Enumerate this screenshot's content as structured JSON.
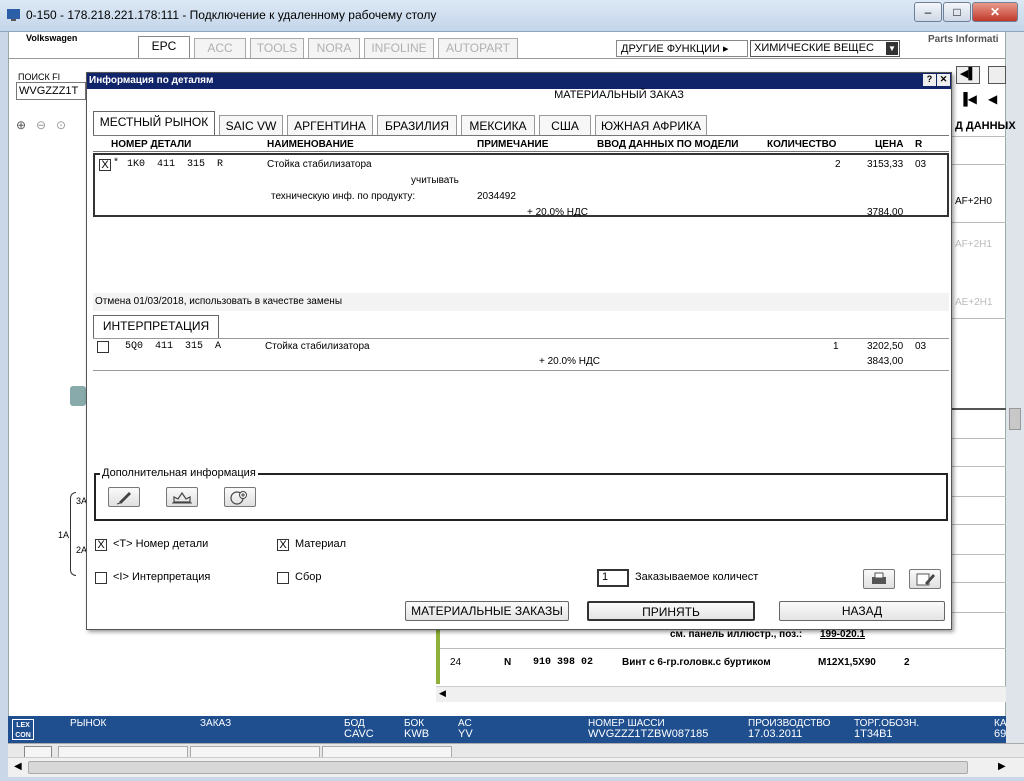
{
  "window": {
    "title": "0-150 - 178.218.221.178:111 - Подключение к удаленному рабочему столу",
    "controls": [
      "–",
      "□",
      "✕"
    ]
  },
  "app": {
    "brand": "Volkswagen",
    "logo_text": "Parts Informati",
    "tabs": [
      "EPC",
      "ACC",
      "TOOLS",
      "NORA",
      "INFOLINE",
      "AUTOPART"
    ],
    "other_functions": "ДРУГИЕ ФУНКЦИИ ▸",
    "chem_select": "ХИМИЧЕСКИЕ ВЕЩЕС",
    "search_label": "ПОИСК FI",
    "search_value": "WVGZZZ1T",
    "right_header": "Д ДАННЫХ",
    "bg_codes": [
      "AF+2H0",
      "AF+2H1",
      "AE+2H1"
    ],
    "tree_labels": [
      "3A",
      "1A",
      "2A"
    ],
    "panel_text": "см. панель иллюстр., поз.:",
    "panel_link": "199-020.1",
    "bg_row": {
      "pos": "24",
      "flag": "N",
      "part": "910 398 02",
      "name": "Винт с 6-гр.головк.с буртиком",
      "spec": "M12X1,5X90",
      "qty": "2"
    }
  },
  "status_bar": {
    "logo": "LEX CON",
    "fields": [
      {
        "label": "РЫНОК",
        "value": ""
      },
      {
        "label": "ЗАКАЗ",
        "value": ""
      },
      {
        "label": "БОД",
        "value": "CAVC"
      },
      {
        "label": "БОК",
        "value": "KWB"
      },
      {
        "label": "АС",
        "value": "YV"
      },
      {
        "label": "НОМЕР ШАССИ",
        "value": "WVGZZZ1TZBW087185"
      },
      {
        "label": "ПРОИЗВОДСТВО",
        "value": "17.03.2011"
      },
      {
        "label": "ТОРГ.ОБОЗН.",
        "value": "1T34B1"
      },
      {
        "label": "КА",
        "value": "69"
      }
    ]
  },
  "dialog": {
    "title": "Информация по деталям",
    "help": "?",
    "close": "✕",
    "heading": "МАТЕРИАЛЬНЫЙ ЗАКАЗ",
    "market_tabs": [
      "МЕСТНЫЙ РЫНОК",
      "SAIC VW",
      "АРГЕНТИНА",
      "БРАЗИЛИЯ",
      "МЕКСИКА",
      "США",
      "ЮЖНАЯ АФРИКА"
    ],
    "columns": [
      "НОМЕР ДЕТАЛИ",
      "НАИМЕНОВАНИЕ",
      "ПРИМЕЧАНИЕ",
      "ВВОД ДАННЫХ ПО МОДЕЛИ",
      "КОЛИЧЕСТВО",
      "ЦЕНА",
      "R"
    ],
    "main_item": {
      "checked": "X",
      "star": "*",
      "part": "1K0  411  315  R",
      "name": "Стойка стабилизатора",
      "note1": "учитывать",
      "note2": "техническую инф. по продукту:",
      "note2_value": "2034492",
      "qty": "2",
      "price": "3153,33",
      "r": "03",
      "vat_label": "+ 20.0% НДС",
      "vat_price": "3784,00"
    },
    "replacement_text": "Отмена 01/03/2018, использовать в качестве замены",
    "interp_tab": "ИНТЕРПРЕТАЦИЯ",
    "interp_item": {
      "part": "5Q0  411  315  A",
      "name": "Стойка стабилизатора",
      "qty": "1",
      "price": "3202,50",
      "r": "03",
      "vat_label": "+ 20.0% НДС",
      "vat_price": "3843,00"
    },
    "extra_info_label": "Дополнительная информация",
    "extra_icons": [
      "pencil-icon",
      "crown-tool-icon",
      "circle-plus-icon"
    ],
    "options": {
      "part_number": "<T> Номер детали",
      "material": "Материал",
      "interpretation": "<I> Интерпретация",
      "assembly": "Сбор"
    },
    "order_qty_value": "1",
    "order_qty_label": "Заказываемое количест",
    "buttons": {
      "material_orders": "МАТЕРИАЛЬНЫЕ ЗАКАЗЫ",
      "accept": "ПРИНЯТЬ",
      "back": "НАЗАД"
    }
  }
}
